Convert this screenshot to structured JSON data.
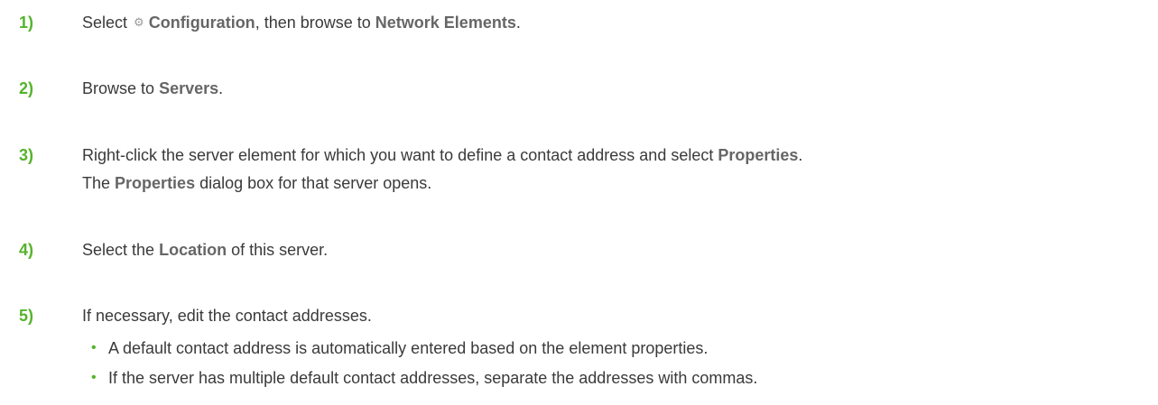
{
  "steps": [
    {
      "number": "1)",
      "line1": {
        "t1": "Select",
        "icon": "gear-icon",
        "b1": "Configuration",
        "t2": ", then browse to",
        "b2": "Network Elements",
        "t3": "."
      }
    },
    {
      "number": "2)",
      "line1": {
        "t1": "Browse to",
        "b1": "Servers",
        "t2": "."
      }
    },
    {
      "number": "3)",
      "line1": {
        "t1": "Right-click the server element for which you want to define a contact address and select",
        "b1": "Properties",
        "t2": "."
      },
      "line2": {
        "t1": "The",
        "b1": "Properties",
        "t2": "dialog box for that server opens."
      }
    },
    {
      "number": "4)",
      "line1": {
        "t1": "Select the",
        "b1": "Location",
        "t2": "of this server."
      }
    },
    {
      "number": "5)",
      "line1": {
        "t1": "If necessary, edit the contact addresses."
      },
      "bullets": [
        "A default contact address is automatically entered based on the element properties.",
        "If the server has multiple default contact addresses, separate the addresses with commas."
      ]
    }
  ],
  "colors": {
    "accent_green": "#55b32b",
    "ui_label": "#666666",
    "body_text": "#3a3a3a"
  }
}
